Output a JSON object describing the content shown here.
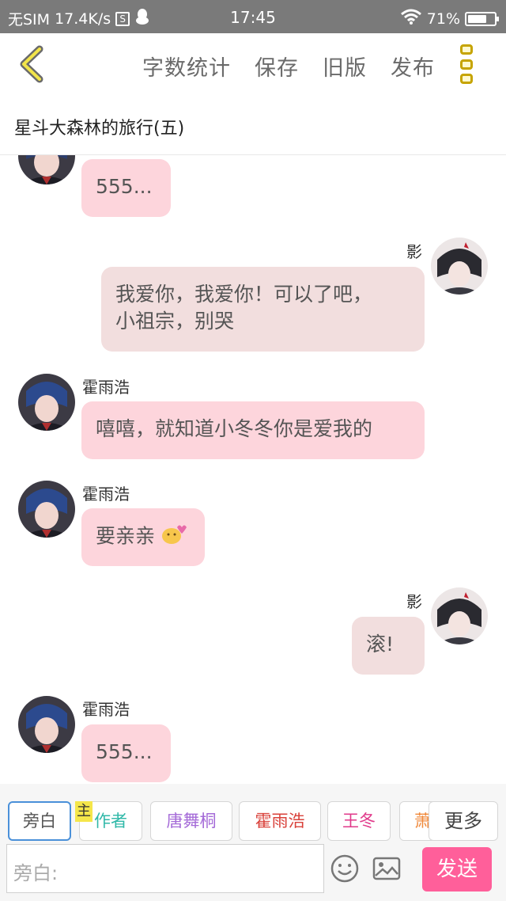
{
  "status_bar": {
    "carrier": "无SIM",
    "speed": "17.4K/s",
    "s_badge": "S",
    "time": "17:45",
    "battery": "71%",
    "battery_level": 0.71
  },
  "toolbar": {
    "word_count": "字数统计",
    "save": "保存",
    "old_version": "旧版",
    "publish": "发布"
  },
  "title": "星斗大森林的旅行(五)",
  "messages": [
    {
      "side": "left",
      "name": "",
      "text": "555..."
    },
    {
      "side": "right",
      "name": "影",
      "text_line1": "我爱你，我爱你！可以了吧，",
      "text_line2": "小祖宗，别哭"
    },
    {
      "side": "left",
      "name": "霍雨浩",
      "text": "嘻嘻，就知道小冬冬你是爱我的"
    },
    {
      "side": "left",
      "name": "霍雨浩",
      "text": "要亲亲"
    },
    {
      "side": "right",
      "name": "影",
      "text": "滚!"
    },
    {
      "side": "left",
      "name": "霍雨浩",
      "text": "555..."
    }
  ],
  "roles": {
    "narration": "旁白",
    "author_badge": "主",
    "author": "作者",
    "role1": "唐舞桐",
    "role2": "霍雨浩",
    "role3": "王冬",
    "role4": "萧",
    "more": "更多"
  },
  "role_colors": {
    "narration": "#555555",
    "author": "#2fb8a8",
    "role1": "#a56bd8",
    "role2": "#d9413a",
    "role3": "#e0398a",
    "role4": "#f08a3c"
  },
  "input": {
    "placeholder": "旁白:",
    "send": "发送"
  },
  "icons": [
    "back-icon",
    "more-vertical-icon",
    "emoji-icon",
    "image-icon"
  ]
}
